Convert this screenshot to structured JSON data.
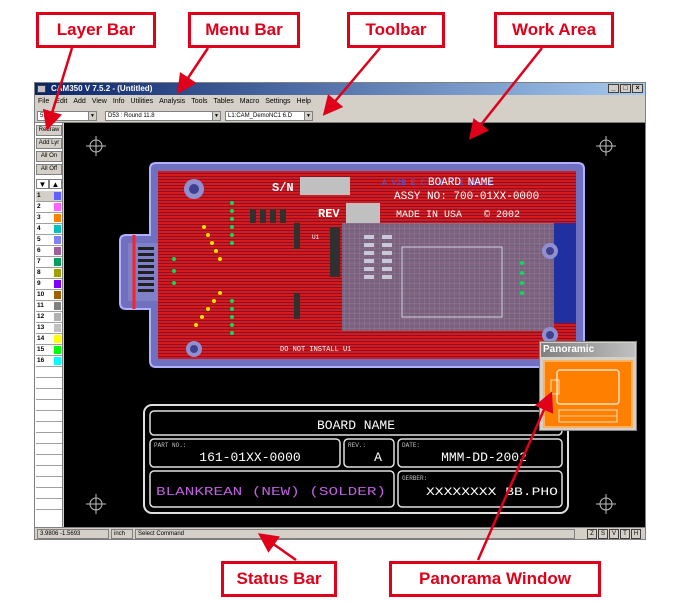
{
  "callouts": {
    "layer_bar": "Layer Bar",
    "menu_bar": "Menu Bar",
    "toolbar": "Toolbar",
    "work_area": "Work Area",
    "status_bar": "Status Bar",
    "panorama_window": "Panorama Window"
  },
  "window": {
    "title": "CAM350 V 7.5.2 - (Untitled)",
    "buttons": [
      "_",
      "□",
      "×"
    ]
  },
  "menu": [
    "File",
    "Edit",
    "Add",
    "View",
    "Info",
    "Utilities",
    "Analysis",
    "Tools",
    "Tables",
    "Macro",
    "Settings",
    "Help"
  ],
  "toolbar": {
    "grid_value": "5.0",
    "dcode_value": "D53 : Round 11.8",
    "layer_value": "L1:CAM_DemoNC1 6.D"
  },
  "layer_panel": {
    "buttons": [
      "Redraw",
      "Add Lyr",
      "All On",
      "All Off"
    ],
    "arrows": [
      "▼",
      "▲"
    ],
    "layers": [
      {
        "num": "1",
        "color": "#6060ff"
      },
      {
        "num": "2",
        "color": "#ff60ff"
      },
      {
        "num": "3",
        "color": "#ff8000"
      },
      {
        "num": "4",
        "color": "#00c0c0"
      },
      {
        "num": "5",
        "color": "#8080ff"
      },
      {
        "num": "6",
        "color": "#a060a0"
      },
      {
        "num": "7",
        "color": "#00a060"
      },
      {
        "num": "8",
        "color": "#a0a000"
      },
      {
        "num": "9",
        "color": "#8000ff"
      },
      {
        "num": "10",
        "color": "#a06000"
      },
      {
        "num": "11",
        "color": "#808080"
      },
      {
        "num": "12",
        "color": "#b0b0b0"
      },
      {
        "num": "13",
        "color": "#c0c0c0"
      },
      {
        "num": "14",
        "color": "#ffff00"
      },
      {
        "num": "15",
        "color": "#00ff00"
      },
      {
        "num": "16",
        "color": "#00ffff"
      }
    ]
  },
  "board": {
    "sn_label": "S/N",
    "rev_label": "REV",
    "header_line": "A V2B E C L  R T E  (DEE)",
    "name": "BOARD NAME",
    "assy": "ASSY NO: 700-01XX-0000",
    "made_in": "MADE IN USA",
    "year": "© 2002",
    "note": "DO NOT INSTALL U1",
    "u1_label": "U1"
  },
  "title_block": {
    "board_name": "BOARD NAME",
    "part_no_label": "PART NO.:",
    "part_no": "161-01XX-0000",
    "rev_label": "REV.:",
    "rev": "A",
    "date_label": "DATE:",
    "date": "MMM-DD-2002",
    "desc": "BLANKREAN (NEW) (SOLDER)",
    "gerber_label": "GERBER:",
    "gerber": "XXXXXXXX BB.PHO"
  },
  "panorama": {
    "title": "Panoramic"
  },
  "status": {
    "coords": "3.9806 -1.5693",
    "units": "inch",
    "message": "Select Command",
    "buttons": [
      "Z",
      "S",
      "V",
      "T",
      "H"
    ]
  },
  "colors": {
    "accent_red": "#e0001a",
    "board_red": "#d41a1a",
    "board_outline": "#9090e0",
    "panorama_orange": "#ff7f00"
  }
}
